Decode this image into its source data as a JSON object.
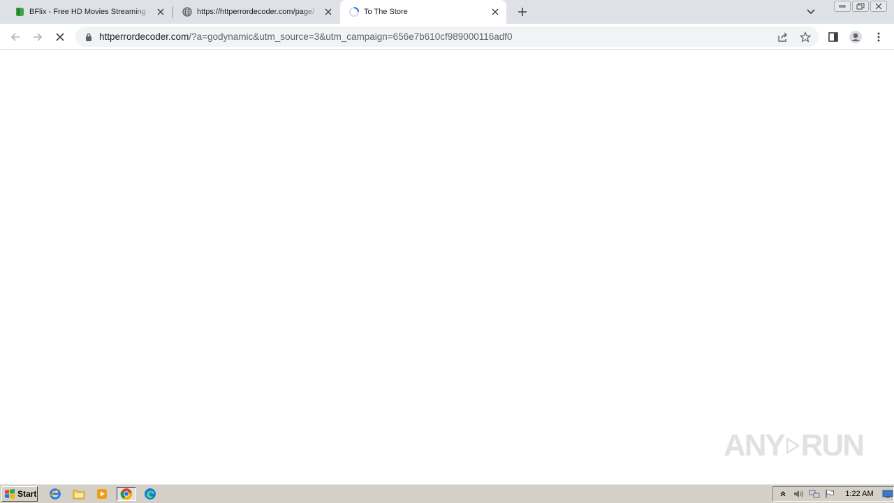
{
  "browser": {
    "tabs": [
      {
        "title": "BFlix - Free HD Movies Streaming - W",
        "favicon": "bflix-icon",
        "active": false
      },
      {
        "title": "https://httperrordecoder.com/page/",
        "favicon": "globe-icon",
        "active": false
      },
      {
        "title": "To The Store",
        "favicon": "loading-spinner-icon",
        "active": true
      }
    ],
    "url": {
      "host": "httperrordecoder.com",
      "path": "/?a=godynamic&utm_source=3&utm_campaign=656e7b610cf989000116adf0"
    }
  },
  "watermark": {
    "text_left": "ANY",
    "text_right": "RUN"
  },
  "taskbar": {
    "start_label": "Start",
    "clock": "1:22 AM"
  },
  "colors": {
    "tabstrip": "#dee1e6",
    "omnibox": "#f1f3f4",
    "taskbar": "#d4d0c8",
    "bflix_green": "#3fa24a",
    "chrome_blue": "#1a73e8"
  }
}
